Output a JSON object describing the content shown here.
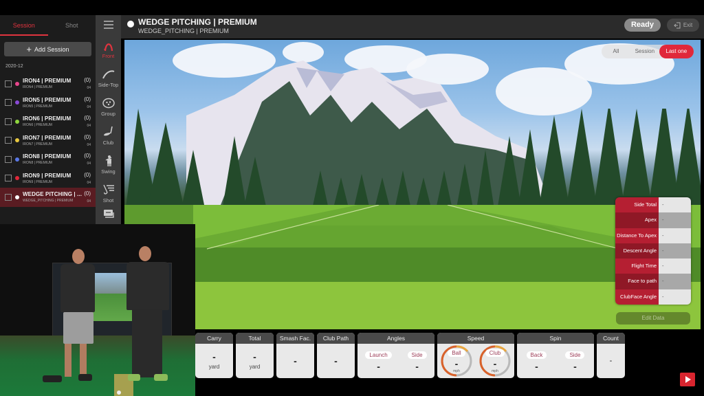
{
  "left_panel": {
    "tabs": [
      {
        "label": "Session",
        "active": true
      },
      {
        "label": "Shot",
        "active": false
      }
    ],
    "add_session_label": "Add Session",
    "month_label": "2020-12",
    "sessions": [
      {
        "title": "IRON4 | PREMIUM",
        "subtitle": "IRON4 | PREMIUM",
        "count": "(0)",
        "number": "04",
        "color": "#e8468c",
        "selected": false
      },
      {
        "title": "IRON5 | PREMIUM",
        "subtitle": "IRON5 | PREMIUM",
        "count": "(0)",
        "number": "04",
        "color": "#8a4ad6",
        "selected": false
      },
      {
        "title": "IRON6 | PREMIUM",
        "subtitle": "IRON6 | PREMIUM",
        "count": "(0)",
        "number": "04",
        "color": "#8fd63e",
        "selected": false
      },
      {
        "title": "IRON7 | PREMIUM",
        "subtitle": "IRON7 | PREMIUM",
        "count": "(0)",
        "number": "04",
        "color": "#e8c840",
        "selected": false
      },
      {
        "title": "IRON8 | PREMIUM",
        "subtitle": "IRON8 | PREMIUM",
        "count": "(0)",
        "number": "04",
        "color": "#5a78e6",
        "selected": false
      },
      {
        "title": "IRON9 | PREMIUM",
        "subtitle": "IRON9 | PREMIUM",
        "count": "(0)",
        "number": "04",
        "color": "#e0283a",
        "selected": false
      },
      {
        "title": "WEDGE PITCHING | ...",
        "subtitle": "WEDGE_PITCHING | PREMIUM",
        "count": "(0)",
        "number": "04",
        "color": "#ffffff",
        "selected": true
      }
    ]
  },
  "view_bar": {
    "items": [
      {
        "label": "Front",
        "icon": "front-trajectory-icon",
        "active": true
      },
      {
        "label": "Side-Top",
        "icon": "side-top-trajectory-icon",
        "active": false
      },
      {
        "label": "Group",
        "icon": "group-dispersion-icon",
        "active": false
      },
      {
        "label": "Club",
        "icon": "club-icon",
        "active": false
      },
      {
        "label": "Swing",
        "icon": "swing-icon",
        "active": false
      },
      {
        "label": "Shot",
        "icon": "shot-list-icon",
        "active": false
      }
    ]
  },
  "header": {
    "title": "WEDGE PITCHING | PREMIUM",
    "subtitle": "WEDGE_PITCHING | PREMIUM",
    "status_label": "Ready",
    "exit_label": "Exit"
  },
  "game_view": {
    "filter_options": [
      {
        "label": "All",
        "active": false
      },
      {
        "label": "Session",
        "active": false
      },
      {
        "label": "Last one",
        "active": true
      }
    ],
    "shot_table": [
      {
        "label": "Side Total",
        "value": "-"
      },
      {
        "label": "Apex",
        "value": "-"
      },
      {
        "label": "Distance To Apex",
        "value": "-"
      },
      {
        "label": "Descent Angle",
        "value": "-"
      },
      {
        "label": "Flight Time",
        "value": "-"
      },
      {
        "label": "Face to path",
        "value": "-"
      },
      {
        "label": "ClubFace Angle",
        "value": "-"
      }
    ],
    "edit_data_label": "Edit Data"
  },
  "metrics": {
    "carry": {
      "label": "Carry",
      "value": "-",
      "unit": "yard"
    },
    "total": {
      "label": "Total",
      "value": "-",
      "unit": "yard"
    },
    "smash": {
      "label": "Smash Fac.",
      "value": "-"
    },
    "club_path": {
      "label": "Club Path",
      "value": "-"
    },
    "angles": {
      "label": "Angles",
      "launch_label": "Launch",
      "launch_value": "-",
      "side_label": "Side",
      "side_value": "-"
    },
    "speed": {
      "label": "Speed",
      "ball_label": "Ball",
      "ball_value": "-",
      "ball_unit": "mph",
      "club_label": "Club",
      "club_value": "-",
      "club_unit": "mph"
    },
    "spin": {
      "label": "Spin",
      "back_label": "Back",
      "back_value": "-",
      "side_label": "Side",
      "side_value": "-"
    },
    "count": {
      "label": "Count",
      "value": "-"
    }
  },
  "colors": {
    "accent": "#e0283a",
    "panel_dark": "#1c1c1c",
    "selected_row": "#5a1c22"
  }
}
